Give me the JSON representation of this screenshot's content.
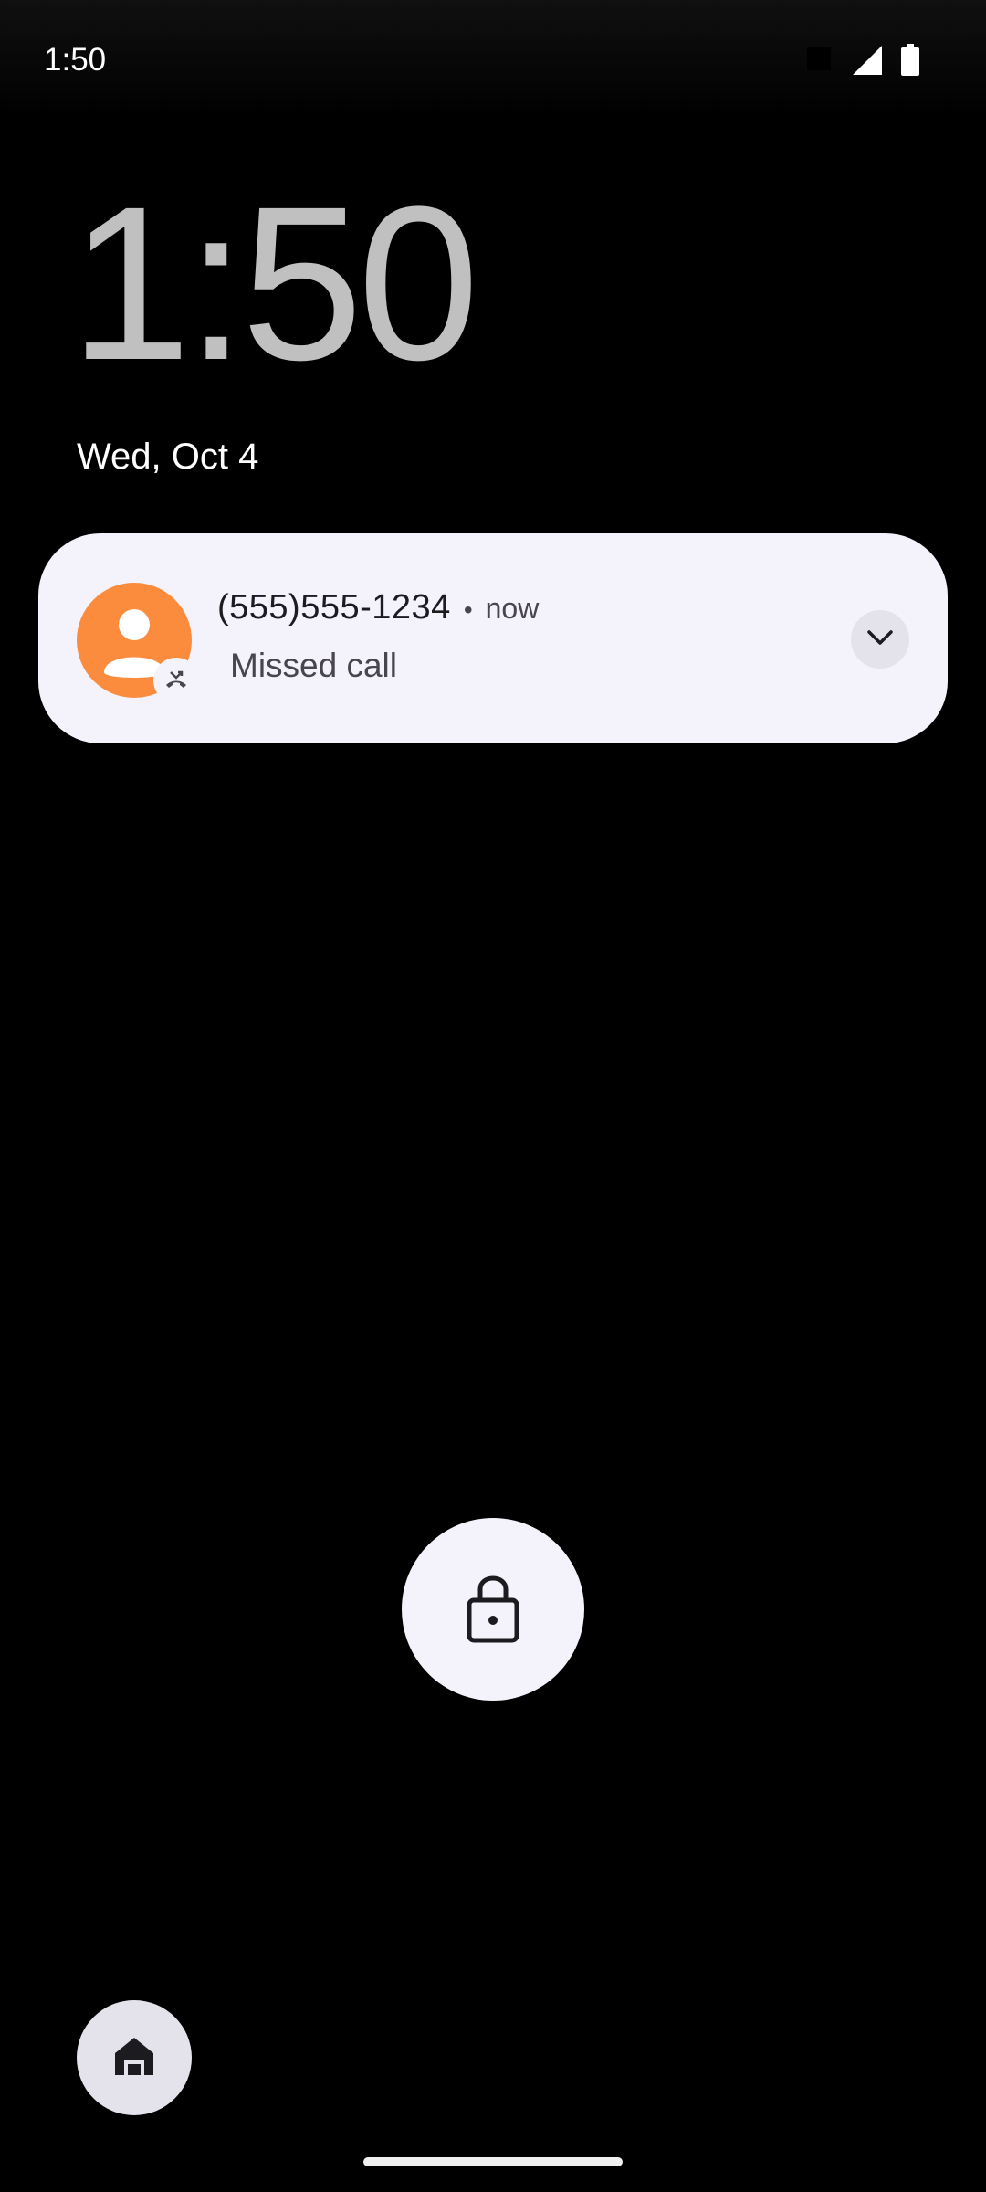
{
  "status_bar": {
    "time": "1:50",
    "icons": [
      "notification-dot-icon",
      "cellular-signal-icon",
      "battery-icon"
    ]
  },
  "lock_screen": {
    "clock": "1:50",
    "date": "Wed, Oct 4"
  },
  "notification": {
    "title": "(555)555-1234",
    "separator": "•",
    "time": "now",
    "text": "Missed call",
    "avatar_color": "#fb8c3e",
    "icons": [
      "avatar-icon",
      "missed-call-icon",
      "chevron-down-icon"
    ]
  },
  "controls": {
    "lock_icon": "lock-icon",
    "home_icon": "home-icon"
  },
  "colors": {
    "background": "#000000",
    "card": "#f4f3fb",
    "clock": "#c0c0c0"
  }
}
